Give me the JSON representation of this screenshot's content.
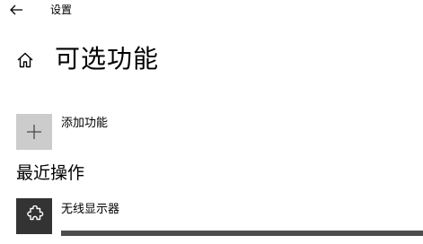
{
  "window": {
    "title": "设置"
  },
  "page": {
    "title": "可选功能"
  },
  "add_feature": {
    "label": "添加功能"
  },
  "recent_actions": {
    "heading": "最近操作",
    "items": [
      {
        "name": "无线显示器",
        "icon": "puzzle-piece-icon",
        "progress_fraction": 1.0
      }
    ]
  },
  "colors": {
    "tile_light": "#cccccc",
    "tile_dark": "#333333",
    "progress_fill": "#4d4d4d",
    "progress_track": "#e6e6e6"
  }
}
